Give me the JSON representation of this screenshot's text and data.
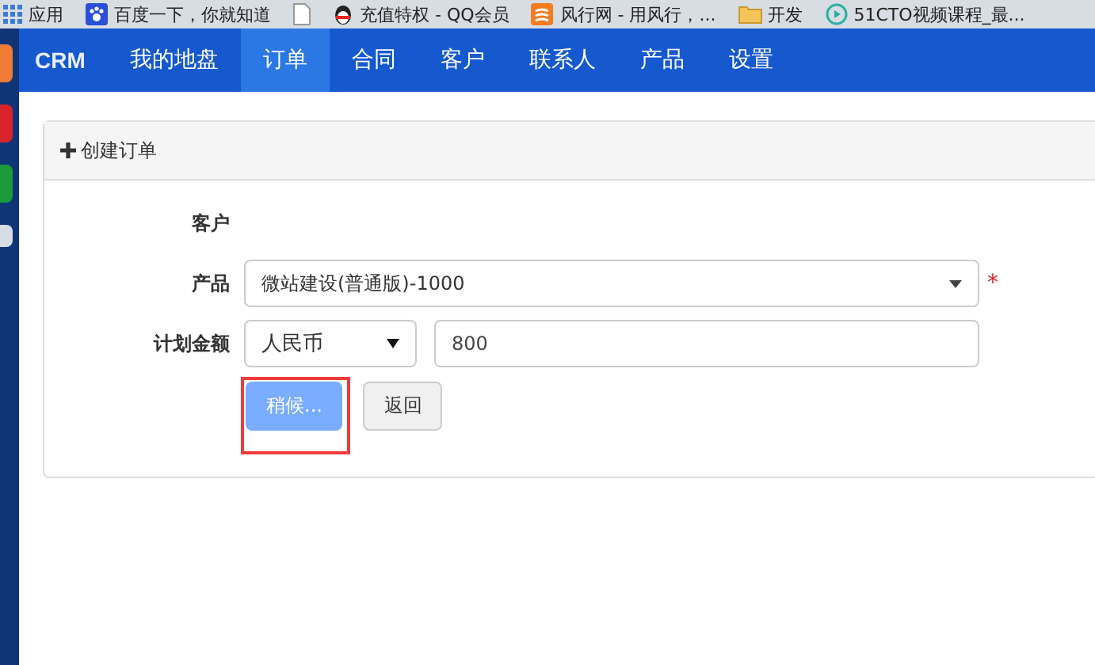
{
  "bookmarks": [
    {
      "label": "应用",
      "kind": "apps"
    },
    {
      "label": "百度一下，你就知道",
      "kind": "paw"
    },
    {
      "kind": "page"
    },
    {
      "label": "充值特权 - QQ会员",
      "kind": "penguin"
    },
    {
      "label": "风行网 - 用风行，...",
      "kind": "wave"
    },
    {
      "label": "开发",
      "kind": "folder"
    },
    {
      "label": "51CTO视频课程_最...",
      "kind": "play"
    }
  ],
  "navbar": {
    "brand": "CRM",
    "items": [
      {
        "label": "我的地盘",
        "selected": false
      },
      {
        "label": "订单",
        "selected": true
      },
      {
        "label": "合同",
        "selected": false
      },
      {
        "label": "客户",
        "selected": false
      },
      {
        "label": "联系人",
        "selected": false
      },
      {
        "label": "产品",
        "selected": false
      },
      {
        "label": "设置",
        "selected": false
      }
    ]
  },
  "panel": {
    "title": "创建订单",
    "fields": [
      {
        "kind": "empty",
        "label": "客户"
      },
      {
        "kind": "select",
        "label": "产品",
        "value": "微站建设(普通版)-1000",
        "required_mark": "*"
      },
      {
        "kind": "money",
        "label": "计划金额",
        "currency": "人民币",
        "value": "800"
      }
    ],
    "buttons": [
      {
        "label": "稍候...",
        "kind": "primary",
        "disabled": true,
        "highlighted": true
      },
      {
        "label": "返回",
        "kind": "default",
        "disabled": false,
        "highlighted": false
      }
    ]
  }
}
